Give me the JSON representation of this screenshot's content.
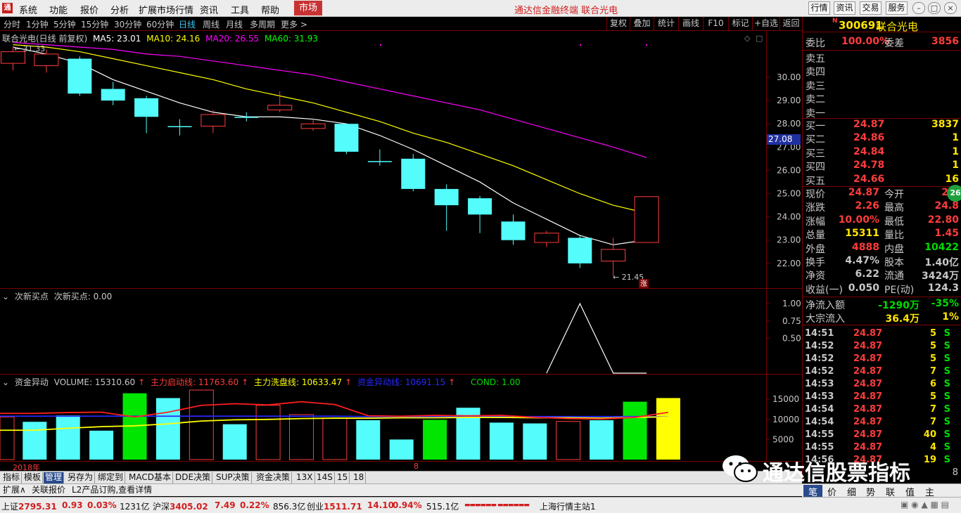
{
  "menu": {
    "logo": "通",
    "items": [
      "系统",
      "功能",
      "报价",
      "分析",
      "扩展市场行情",
      "资讯",
      "工具",
      "帮助"
    ],
    "market": "市场",
    "title": "通达信金融终端  联合光电",
    "buttons": [
      "行情",
      "资讯",
      "交易",
      "服务"
    ]
  },
  "periods": {
    "items": [
      "分时",
      "1分钟",
      "5分钟",
      "15分钟",
      "30分钟",
      "60分钟",
      "日线",
      "周线",
      "月线",
      "多周期",
      "更多 >"
    ],
    "selected": "日线",
    "right": [
      "复权",
      "叠加",
      "统计",
      "画线",
      "F10",
      "标记",
      "+自选",
      "返回"
    ]
  },
  "main": {
    "title": "联合光电(日线 前复权)",
    "ma5": "MA5: 23.01",
    "ma10": "MA10: 24.16",
    "ma20": "MA20: 26.55",
    "ma60": "MA60: 31.93",
    "hi_label": "31.33",
    "lo_label": "21.45",
    "zhang": "涨",
    "price_tag": "27.08",
    "yaxis": [
      "30.00",
      "29.00",
      "28.00",
      "27.00",
      "26.00",
      "25.00",
      "24.00",
      "23.00",
      "22.00"
    ]
  },
  "candles": [
    {
      "o": 30.6,
      "c": 31.1,
      "h": 31.33,
      "l": 30.3,
      "up": true
    },
    {
      "o": 31.0,
      "c": 30.5,
      "h": 31.2,
      "l": 30.2,
      "down": true
    },
    {
      "o": 30.8,
      "c": 29.3,
      "h": 30.9,
      "l": 29.2
    },
    {
      "o": 29.5,
      "c": 29.0,
      "h": 29.8,
      "l": 28.8
    },
    {
      "o": 29.1,
      "c": 28.3,
      "h": 29.2,
      "l": 27.6
    },
    {
      "o": 27.9,
      "c": 27.9,
      "h": 28.2,
      "l": 27.5
    },
    {
      "o": 27.9,
      "c": 28.4,
      "h": 28.6,
      "l": 27.6,
      "up": true
    },
    {
      "o": 28.3,
      "c": 28.3,
      "h": 28.5,
      "l": 28.1
    },
    {
      "o": 28.6,
      "c": 28.8,
      "h": 29.4,
      "l": 28.5,
      "up": true
    },
    {
      "o": 27.8,
      "c": 28.0,
      "h": 28.2,
      "l": 27.7,
      "up": true
    },
    {
      "o": 28.0,
      "c": 26.8,
      "h": 28.0,
      "l": 26.7
    },
    {
      "o": 26.4,
      "c": 26.4,
      "h": 26.9,
      "l": 26.2
    },
    {
      "o": 26.5,
      "c": 25.2,
      "h": 26.7,
      "l": 25.1
    },
    {
      "o": 25.2,
      "c": 24.5,
      "h": 25.4,
      "l": 23.4
    },
    {
      "o": 24.8,
      "c": 24.1,
      "h": 24.9,
      "l": 23.3
    },
    {
      "o": 23.8,
      "c": 23.0,
      "h": 24.1,
      "l": 22.8
    },
    {
      "o": 22.9,
      "c": 23.3,
      "h": 23.4,
      "l": 22.7,
      "up": true
    },
    {
      "o": 23.1,
      "c": 22.0,
      "h": 23.2,
      "l": 21.8
    },
    {
      "o": 22.1,
      "c": 22.6,
      "h": 23.1,
      "l": 21.45,
      "up": true
    },
    {
      "o": 22.9,
      "c": 24.87,
      "h": 24.87,
      "l": 22.9,
      "up": true
    }
  ],
  "ma5_line": [
    31.3,
    31.0,
    30.6,
    29.9,
    29.4,
    28.9,
    28.5,
    28.3,
    28.3,
    28.2,
    28.0,
    27.5,
    26.9,
    26.2,
    25.5,
    24.6,
    23.9,
    23.2,
    22.8,
    23.01
  ],
  "ma10_line": [
    31.4,
    31.3,
    31.1,
    30.8,
    30.5,
    30.2,
    29.9,
    29.5,
    29.2,
    28.9,
    28.5,
    28.1,
    27.6,
    27.2,
    26.7,
    26.2,
    25.6,
    25.0,
    24.5,
    24.16
  ],
  "ma20_line": [
    31.5,
    31.4,
    31.3,
    31.2,
    31.0,
    30.9,
    30.7,
    30.5,
    30.3,
    30.1,
    29.8,
    29.5,
    29.2,
    28.9,
    28.6,
    28.2,
    27.8,
    27.4,
    27.0,
    26.55
  ],
  "indicator": {
    "title": "次新买点",
    "label": "次新买点: 0.00",
    "yaxis": [
      "1.00",
      "0.75",
      "0.50"
    ],
    "values": [
      0,
      0,
      0,
      0,
      0,
      0,
      0,
      0,
      0,
      0,
      0,
      0,
      0,
      0,
      0,
      0,
      0,
      1,
      0,
      0
    ]
  },
  "volume": {
    "title": "资金异动",
    "vol": "VOLUME: 15310.60",
    "l1": "主力启动线: 11763.60",
    "l2": "主力洗盘线: 10633.47",
    "l3": "资金异动线: 10691.15",
    "cond": "COND: 1.00",
    "yaxis": [
      "15000",
      "10000",
      "5000"
    ],
    "bars": [
      {
        "v": 9400,
        "c": "cyan"
      },
      {
        "v": 11000,
        "c": "cyan"
      },
      {
        "v": 7200,
        "c": "cyan"
      },
      {
        "v": 16500,
        "c": "green"
      },
      {
        "v": 15300,
        "c": "cyan"
      },
      {
        "v": 17300,
        "c": "red"
      },
      {
        "v": 8800,
        "c": "cyan"
      },
      {
        "v": 13500,
        "c": "red"
      },
      {
        "v": 11200,
        "c": "red"
      },
      {
        "v": 10300,
        "c": "red"
      },
      {
        "v": 9800,
        "c": "cyan"
      },
      {
        "v": 5000,
        "c": "cyan"
      },
      {
        "v": 9900,
        "c": "green"
      },
      {
        "v": 12900,
        "c": "cyan"
      },
      {
        "v": 9200,
        "c": "cyan"
      },
      {
        "v": 9000,
        "c": "cyan"
      },
      {
        "v": 9500,
        "c": "red"
      },
      {
        "v": 9800,
        "c": "cyan"
      },
      {
        "v": 14400,
        "c": "green"
      },
      {
        "v": 15310,
        "c": "yellow"
      }
    ],
    "line_red": [
      11500,
      11700,
      11800,
      10600,
      11800,
      13500,
      13900,
      13600,
      14400,
      13700,
      10900,
      10800,
      11000,
      10900,
      11000,
      10500,
      10200,
      10100,
      10500,
      11763
    ],
    "line_yellow": [
      7300,
      7800,
      8200,
      8400,
      8900,
      9600,
      9900,
      10000,
      10200,
      10300,
      10300,
      10400,
      10400,
      10500,
      10500,
      10400,
      10400,
      10300,
      10500,
      10633
    ],
    "line_blue": [
      10800,
      10800,
      10800,
      10800,
      10800,
      10800,
      10800,
      10800,
      10800,
      10800,
      10700,
      10700,
      10700,
      10700,
      10700,
      10700,
      10700,
      10700,
      10700,
      10691
    ]
  },
  "datebar": {
    "year": "2018年",
    "month": "8"
  },
  "indtabs": [
    "指标",
    "模板",
    "管理",
    "另存为",
    "绑定到",
    "MACD基本",
    "DDE决策",
    "SUP决策",
    "资金决策",
    "13X",
    "14S",
    "15",
    "18"
  ],
  "exttabs": [
    "扩展∧",
    "关联报价",
    "L2产品订购,查看详情"
  ],
  "quote": {
    "badge": "N",
    "code": "300691",
    "name": "联合光电",
    "weibi_l": "委比",
    "weibi": "100.00%",
    "weicha_l": "委差",
    "weicha": "3856",
    "sells": [
      {
        "l": "卖五"
      },
      {
        "l": "卖四"
      },
      {
        "l": "卖三"
      },
      {
        "l": "卖二"
      },
      {
        "l": "卖一"
      }
    ],
    "buys": [
      {
        "l": "买一",
        "p": "24.87",
        "q": "3837"
      },
      {
        "l": "买二",
        "p": "24.86",
        "q": "1"
      },
      {
        "l": "买三",
        "p": "24.84",
        "q": "1"
      },
      {
        "l": "买四",
        "p": "24.78",
        "q": "1"
      },
      {
        "l": "买五",
        "p": "24.66",
        "q": "16"
      }
    ],
    "stats": [
      {
        "l1": "现价",
        "v1": "24.87",
        "l2": "今开",
        "v2": "22.",
        "c1": "#ff3c3c",
        "c2": "#ff3c3c"
      },
      {
        "l1": "涨跌",
        "v1": "2.26",
        "l2": "最高",
        "v2": "24.8",
        "c1": "#ff3c3c",
        "c2": "#ff3c3c"
      },
      {
        "l1": "涨幅",
        "v1": "10.00%",
        "l2": "最低",
        "v2": "22.80",
        "c1": "#ff3c3c",
        "c2": "#ff3c3c"
      },
      {
        "l1": "总量",
        "v1": "15311",
        "l2": "量比",
        "v2": "1.45",
        "c1": "#ffe600",
        "c2": "#ff3c3c"
      },
      {
        "l1": "外盘",
        "v1": "4888",
        "l2": "内盘",
        "v2": "10422",
        "c1": "#ff3c3c",
        "c2": "#00dc00"
      },
      {
        "l1": "换手",
        "v1": "4.47%",
        "l2": "股本",
        "v2": "1.40亿",
        "c1": "#c8c8c8",
        "c2": "#c8c8c8"
      },
      {
        "l1": "净资",
        "v1": "6.22",
        "l2": "流通",
        "v2": "3424万",
        "c1": "#c8c8c8",
        "c2": "#c8c8c8"
      },
      {
        "l1": "收益(一)",
        "v1": "0.050",
        "l2": "PE(动)",
        "v2": "124.3",
        "c1": "#c8c8c8",
        "c2": "#c8c8c8"
      }
    ],
    "flow": [
      {
        "l": "净流入额",
        "v": "-1290万",
        "p": "-35%",
        "c": "#00dc00"
      },
      {
        "l": "大宗流入",
        "v": "36.4万",
        "p": "1%",
        "c": "#ffe600"
      }
    ],
    "circle": "26",
    "ticks": [
      {
        "t": "14:51",
        "p": "24.87",
        "q": "5",
        "s": "S"
      },
      {
        "t": "14:52",
        "p": "24.87",
        "q": "5",
        "s": "S"
      },
      {
        "t": "14:52",
        "p": "24.87",
        "q": "5",
        "s": "S"
      },
      {
        "t": "14:52",
        "p": "24.87",
        "q": "7",
        "s": "S"
      },
      {
        "t": "14:53",
        "p": "24.87",
        "q": "6",
        "s": "S"
      },
      {
        "t": "14:53",
        "p": "24.87",
        "q": "5",
        "s": "S"
      },
      {
        "t": "14:54",
        "p": "24.87",
        "q": "7",
        "s": "S"
      },
      {
        "t": "14:54",
        "p": "24.87",
        "q": "7",
        "s": "S"
      },
      {
        "t": "14:55",
        "p": "24.87",
        "q": "40",
        "s": "S"
      },
      {
        "t": "14:55",
        "p": "24.87",
        "q": "4",
        "s": "S"
      },
      {
        "t": "14:56",
        "p": "24.87",
        "q": "19",
        "s": "S"
      }
    ],
    "tick_extra": "8"
  },
  "rptabs": [
    "笔",
    "价",
    "细",
    "势",
    "联",
    "值",
    "主"
  ],
  "status": {
    "sh_l": "上证",
    "sh": "2795.31",
    "sh_c": "0.93",
    "sh_p": "0.03%",
    "sh_a": "1231亿",
    "hs_l": "沪深",
    "hs": "3405.02",
    "hs_c": "7.49",
    "hs_p": "0.22%",
    "hs_a": "856.3亿",
    "cy_l": "创业",
    "cy": "1511.71",
    "cy_c": "14.10",
    "cy_p": "0.94%",
    "cy_a": "515.1亿",
    "site": "上海行情主站1"
  },
  "watermark": "通达信股票指标",
  "colors": {
    "up": "#ff3c3c",
    "down": "#54fcfc",
    "ma5": "#ffffff",
    "ma10": "#ffff00",
    "ma20": "#ff00ff",
    "border": "#7a0000"
  }
}
